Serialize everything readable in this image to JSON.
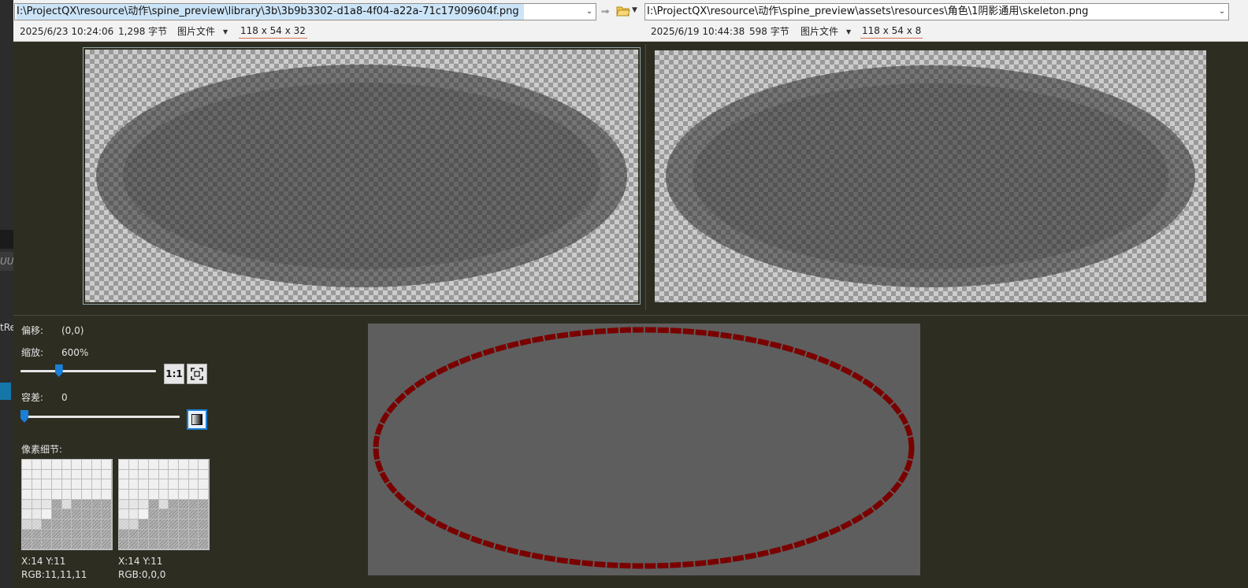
{
  "left_strip": {
    "text_1": "UU",
    "text_2": "tRe"
  },
  "left_file": {
    "path_prefix": "I:\\ProjectQX\\resource\\动作\\spine_preview\\library\\3b\\3b9b3302-d1a8-4f04-a22a-71c17909604f.png",
    "date": "2025/6/23 10:24:06",
    "size": "1,298 字节",
    "type": "图片文件",
    "dims": "118 x 54 x 32"
  },
  "right_file": {
    "path": "I:\\ProjectQX\\resource\\动作\\spine_preview\\assets\\resources\\角色\\1阴影通用\\skeleton.png",
    "date": "2025/6/19 10:44:38",
    "size": "598 字节",
    "type": "图片文件",
    "dims": "118 x 54 x 8"
  },
  "controls": {
    "offset_label": "偏移:",
    "offset_value": "(0,0)",
    "zoom_label": "缩放:",
    "zoom_value": "600%",
    "zoom_slider_fraction": 0.27,
    "one_to_one_label": "1:1",
    "tolerance_label": "容差:",
    "tolerance_value": "0",
    "tolerance_slider_fraction": 0.0,
    "pixel_detail_label": "像素细节:"
  },
  "pixel_detail": {
    "left": {
      "coords": "X:14 Y:11",
      "rgb": "RGB:11,11,11"
    },
    "right": {
      "coords": "X:14 Y:11",
      "rgb": "RGB:0,0,0"
    }
  },
  "colors": {
    "background": "#2d2d22",
    "accent": "#1a7fd6",
    "diff_outline": "#7a0000"
  }
}
